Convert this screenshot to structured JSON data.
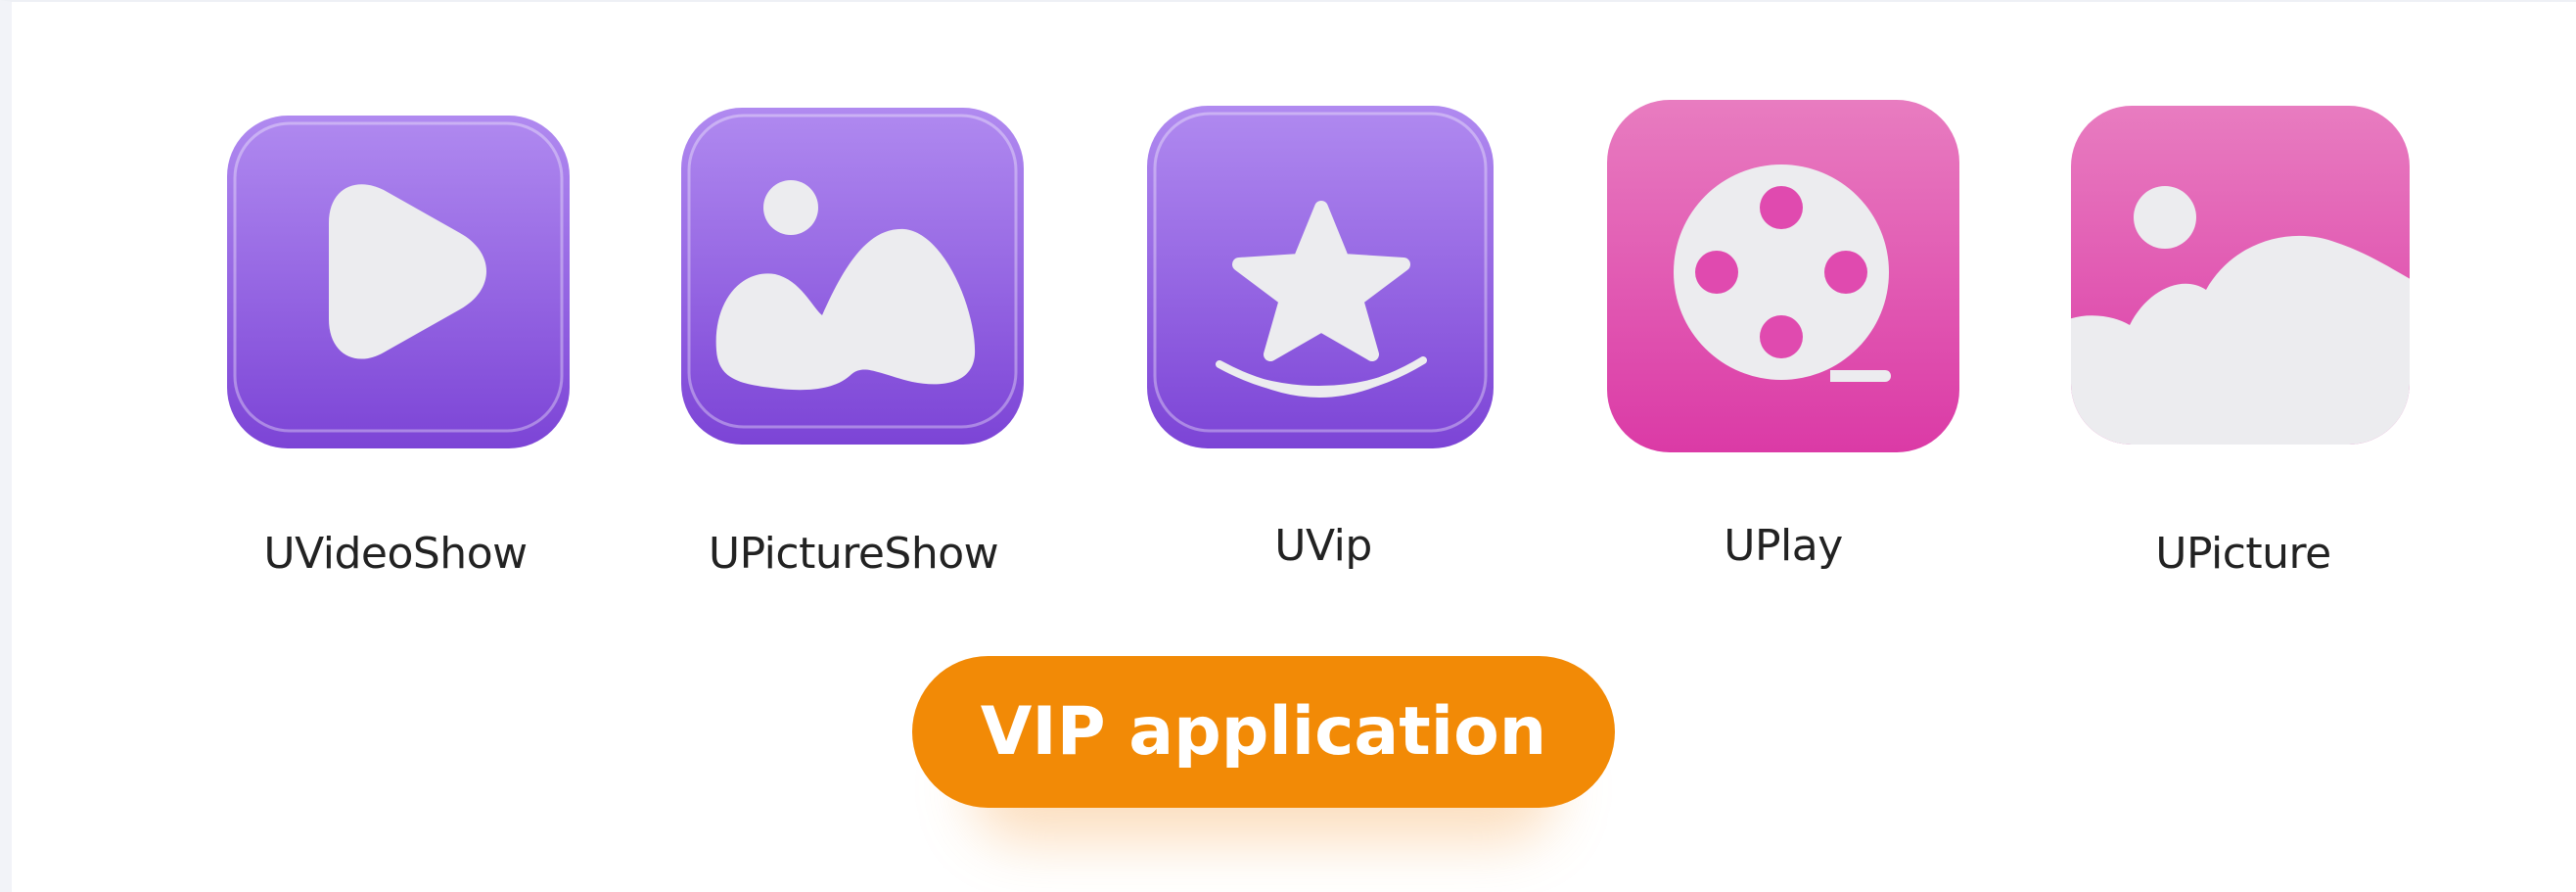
{
  "apps": [
    {
      "id": "uvideoshow",
      "label": "UVideoShow",
      "icon": "play-icon",
      "gradient": [
        "#b08af0",
        "#7c44d6"
      ]
    },
    {
      "id": "upictureshow",
      "label": "UPictureShow",
      "icon": "image-icon",
      "gradient": [
        "#b08af0",
        "#7c44d6"
      ]
    },
    {
      "id": "uvip",
      "label": "UVip",
      "icon": "star-icon",
      "gradient": [
        "#b08af0",
        "#7c44d6"
      ]
    },
    {
      "id": "uplay",
      "label": "UPlay",
      "icon": "film-reel-icon",
      "gradient": [
        "#e87cc0",
        "#db3aa6"
      ]
    },
    {
      "id": "upicture",
      "label": "UPicture",
      "icon": "cloud-picture-icon",
      "gradient": [
        "#e87cc0",
        "#db3aa6"
      ]
    }
  ],
  "cta": {
    "label": "VIP application",
    "color": "#f28a06"
  }
}
